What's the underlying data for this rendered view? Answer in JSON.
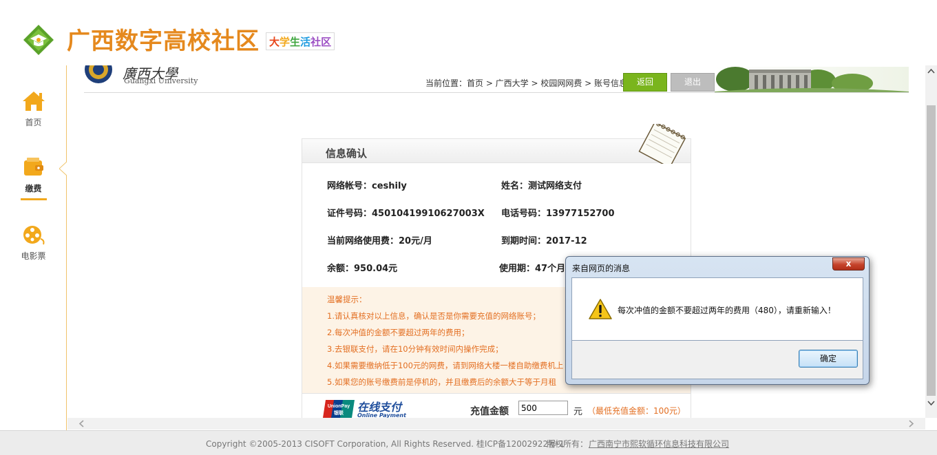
{
  "header": {
    "site_title": "广西数字高校社区",
    "site_subtitle": [
      "大",
      "学",
      "生",
      "活",
      "社区"
    ]
  },
  "leftnav": {
    "items": [
      {
        "label": "首页",
        "icon": "home-icon"
      },
      {
        "label": "缴费",
        "icon": "wallet-icon",
        "active": true
      },
      {
        "label": "电影票",
        "icon": "film-reel-icon"
      }
    ]
  },
  "university": {
    "name_cn": "廣西大學",
    "name_en": "Guangxi University"
  },
  "breadcrumb": "当前位置：首页 > 广西大学 > 校园网网费 > 账号信息",
  "buttons": {
    "back": "返回",
    "logout": "退出"
  },
  "panel": {
    "title": "信息确认",
    "info": {
      "account": "网络帐号：ceshily",
      "name": "姓名：测试网络支付",
      "id_number": "证件号码：45010419910627003X",
      "phone": "电话号码：13977152700",
      "current_fee": "当前网络使用费：20元/月",
      "expire": "到期时间：2017-12",
      "balance": "余额：950.04元",
      "usage_period": "使用期：47个月"
    },
    "tips": {
      "heading": "温馨提示：",
      "items": [
        "1.请认真核对以上信息，确认是否是你需要充值的网络账号；",
        "2.每次冲值的金额不要超过两年的费用；",
        "3.去银联支付，请在10分钟有效时间内操作完成；",
        "4.如果需要缴纳低于100元的网费，请到网络大楼一楼自助缴费机上",
        "5.如果您的账号缴费前是停机的，并且缴费后的余额大于等于月租"
      ]
    },
    "payment": {
      "unionpay_label": "UnionPay 银联",
      "online_pay": "在线支付",
      "online_pay_en": "Online Payment",
      "amount_label": "充值金额",
      "amount_value": "500",
      "unit": "元",
      "min_note": "（最低充值金额：100元）"
    }
  },
  "footer": {
    "copyright": "Copyright ©2005-2013 CISOFT Corporation, All Rights Reserved. 桂ICP备12002922号-1",
    "owner_label": "版权所有：",
    "owner_name": "广西南宁市熙软循环信息科技有限公司"
  },
  "dialog": {
    "title": "来自网页的消息",
    "close": "x",
    "message": "每次冲值的金额不要超过两年的费用（480），请重新输入！",
    "ok": "确定"
  },
  "colors": {
    "accent_orange": "#e5891e",
    "back_green": "#7ab51d",
    "tips_text": "#e36f22",
    "tips_bg": "#fdf3e6"
  }
}
